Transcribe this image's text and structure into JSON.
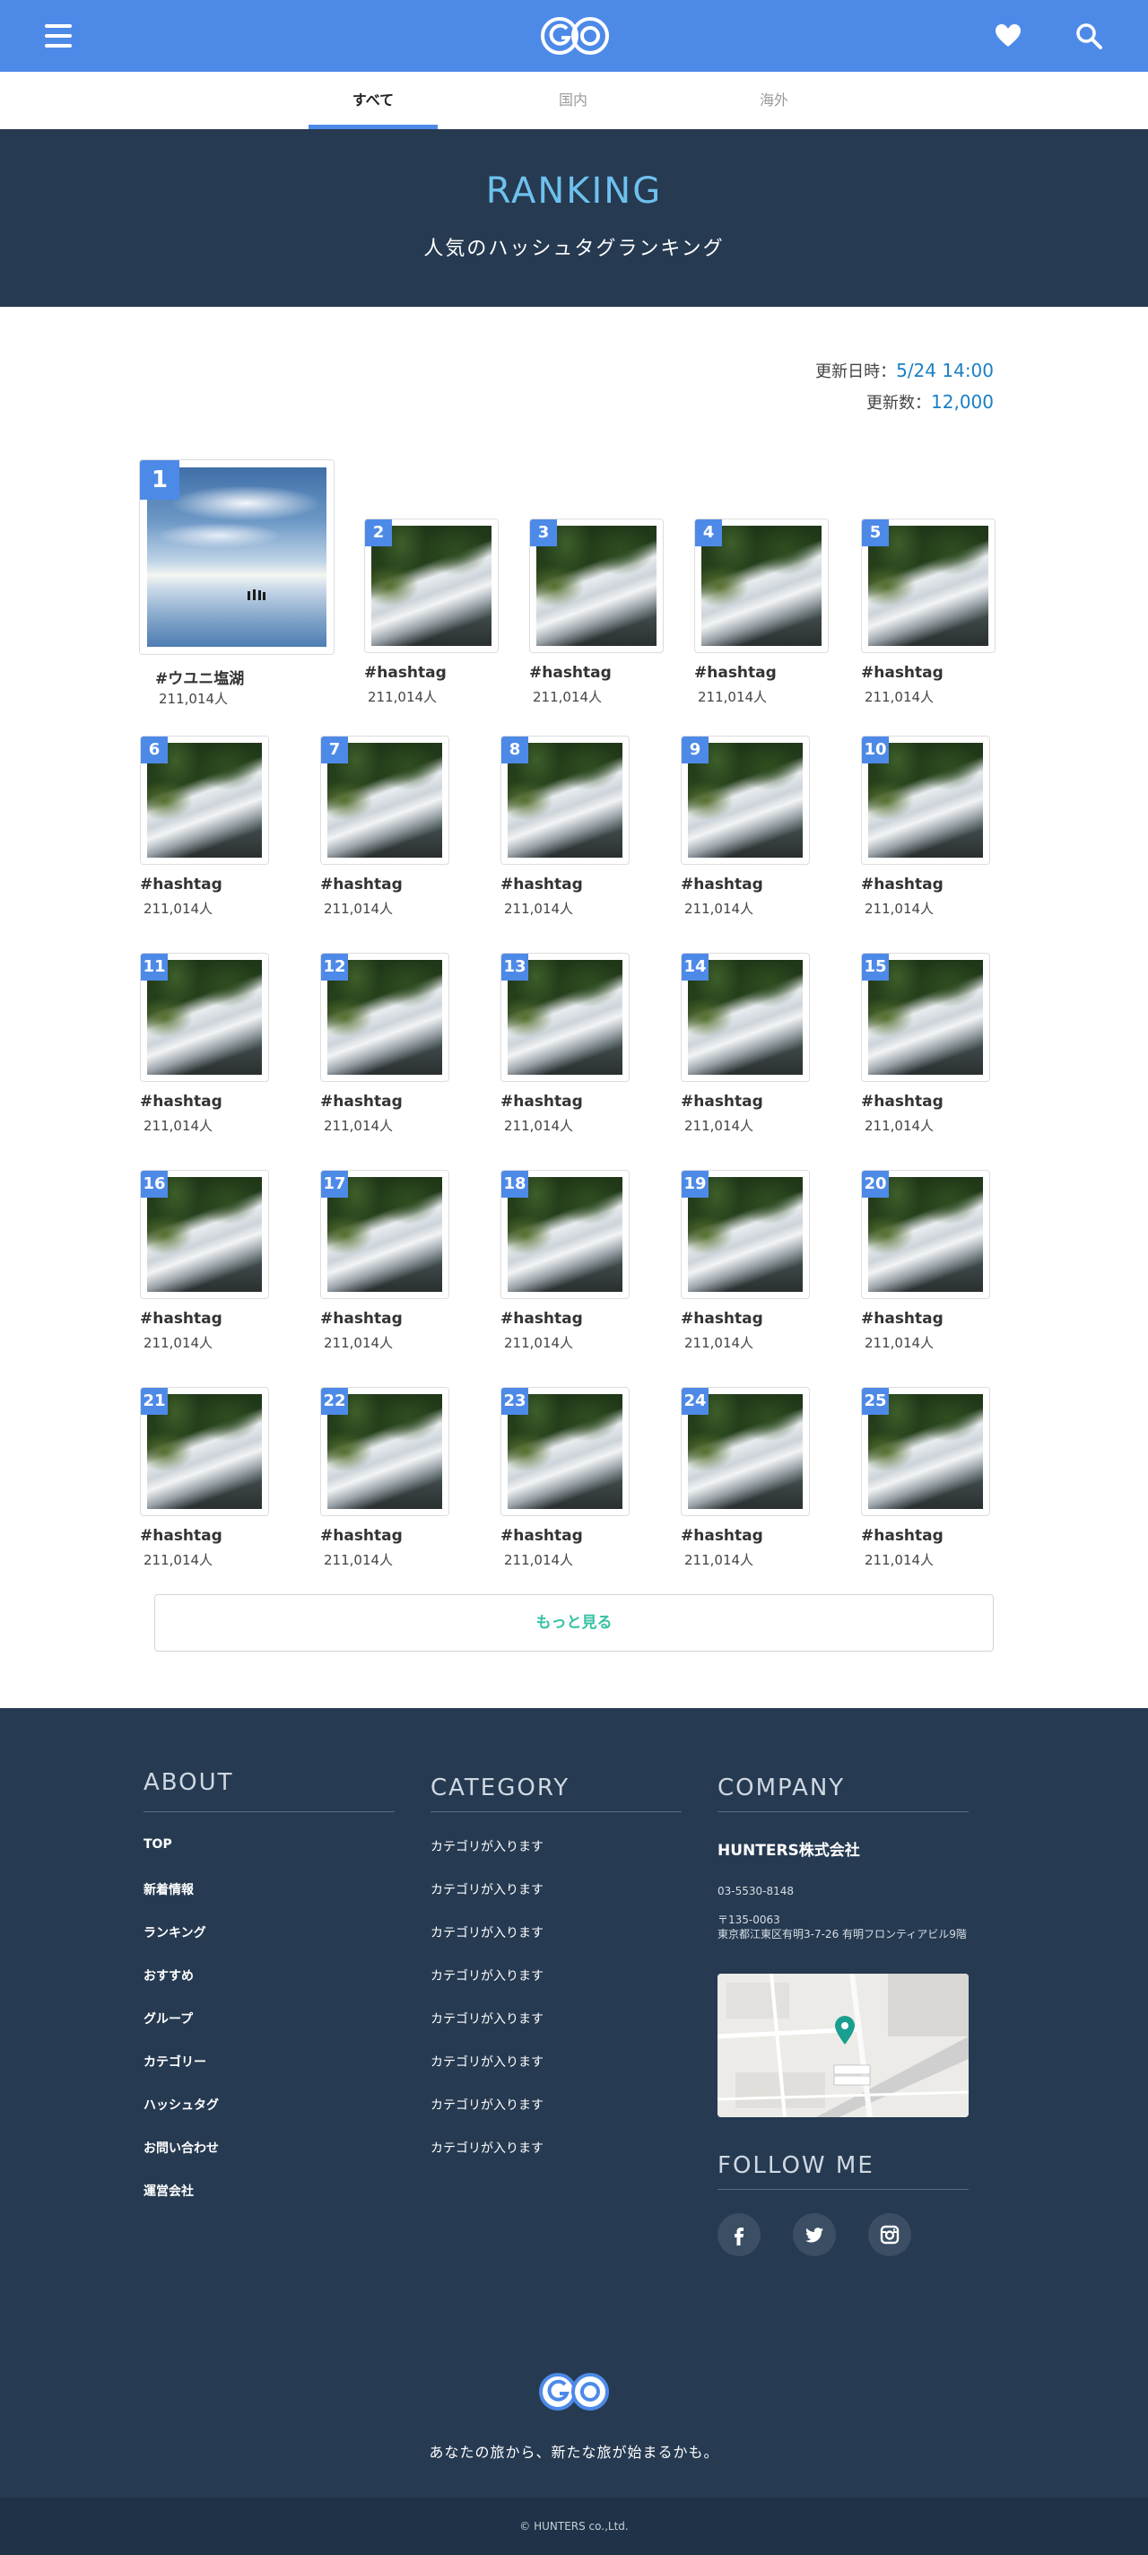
{
  "header": {
    "menu_icon": "hamburger-menu-icon",
    "logo_text": "GO",
    "favorite_icon": "heart-icon",
    "search_icon": "search-icon",
    "brand_color": "#4d8ae8"
  },
  "tabs": [
    {
      "label": "すべて",
      "active": true
    },
    {
      "label": "国内",
      "active": false
    },
    {
      "label": "海外",
      "active": false
    }
  ],
  "hero": {
    "title": "RANKING",
    "subtitle": "人気のハッシュタグランキング"
  },
  "update": {
    "date_label": "更新日時：",
    "date_value": "5/24 14:00",
    "count_label": "更新数：",
    "count_value": "12,000"
  },
  "ranking": [
    {
      "rank": "1",
      "tag": "#ウユニ塩湖",
      "count": "211,014人"
    },
    {
      "rank": "2",
      "tag": "#hashtag",
      "count": "211,014人"
    },
    {
      "rank": "3",
      "tag": "#hashtag",
      "count": "211,014人"
    },
    {
      "rank": "4",
      "tag": "#hashtag",
      "count": "211,014人"
    },
    {
      "rank": "5",
      "tag": "#hashtag",
      "count": "211,014人"
    },
    {
      "rank": "6",
      "tag": "#hashtag",
      "count": "211,014人"
    },
    {
      "rank": "7",
      "tag": "#hashtag",
      "count": "211,014人"
    },
    {
      "rank": "8",
      "tag": "#hashtag",
      "count": "211,014人"
    },
    {
      "rank": "9",
      "tag": "#hashtag",
      "count": "211,014人"
    },
    {
      "rank": "10",
      "tag": "#hashtag",
      "count": "211,014人"
    },
    {
      "rank": "11",
      "tag": "#hashtag",
      "count": "211,014人"
    },
    {
      "rank": "12",
      "tag": "#hashtag",
      "count": "211,014人"
    },
    {
      "rank": "13",
      "tag": "#hashtag",
      "count": "211,014人"
    },
    {
      "rank": "14",
      "tag": "#hashtag",
      "count": "211,014人"
    },
    {
      "rank": "15",
      "tag": "#hashtag",
      "count": "211,014人"
    },
    {
      "rank": "16",
      "tag": "#hashtag",
      "count": "211,014人"
    },
    {
      "rank": "17",
      "tag": "#hashtag",
      "count": "211,014人"
    },
    {
      "rank": "18",
      "tag": "#hashtag",
      "count": "211,014人"
    },
    {
      "rank": "19",
      "tag": "#hashtag",
      "count": "211,014人"
    },
    {
      "rank": "20",
      "tag": "#hashtag",
      "count": "211,014人"
    },
    {
      "rank": "21",
      "tag": "#hashtag",
      "count": "211,014人"
    },
    {
      "rank": "22",
      "tag": "#hashtag",
      "count": "211,014人"
    },
    {
      "rank": "23",
      "tag": "#hashtag",
      "count": "211,014人"
    },
    {
      "rank": "24",
      "tag": "#hashtag",
      "count": "211,014人"
    },
    {
      "rank": "25",
      "tag": "#hashtag",
      "count": "211,014人"
    }
  ],
  "more_button": "もっと見る",
  "footer": {
    "about": {
      "title": "ABOUT",
      "links": [
        "TOP",
        "新着情報",
        "ランキング",
        "おすすめ",
        "グループ",
        "カテゴリー",
        "ハッシュタグ",
        "お問い合わせ",
        "運営会社"
      ]
    },
    "category": {
      "title": "CATEGORY",
      "items": [
        "カテゴリが入ります",
        "カテゴリが入ります",
        "カテゴリが入ります",
        "カテゴリが入ります",
        "カテゴリが入ります",
        "カテゴリが入ります",
        "カテゴリが入ります",
        "カテゴリが入ります"
      ]
    },
    "company": {
      "title": "COMPANY",
      "name": "HUNTERS株式会社",
      "phone": "03-5530-8148",
      "postal": "〒135-0063",
      "address": "東京都江東区有明3-7-26 有明フロンティアビル9階",
      "map_icon": "map-pin-icon"
    },
    "follow": {
      "title": "FOLLOW ME",
      "icons": [
        "facebook-icon",
        "twitter-icon",
        "instagram-icon"
      ]
    },
    "logo_text": "GO",
    "tagline": "あなたの旅から、新たな旅が始まるかも。",
    "copyright": "© HUNTERS co.,Ltd."
  }
}
